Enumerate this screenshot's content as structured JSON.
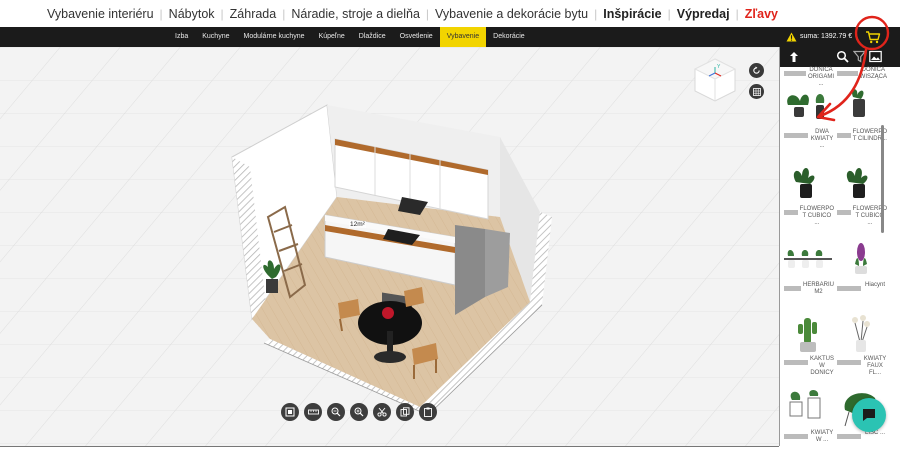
{
  "site_nav": {
    "items": [
      {
        "label": "Vybavenie interiéru",
        "style": "normal"
      },
      {
        "label": "Nábytok",
        "style": "normal"
      },
      {
        "label": "Záhrada",
        "style": "normal"
      },
      {
        "label": "Náradie, stroje a dielňa",
        "style": "normal"
      },
      {
        "label": "Vybavenie a dekorácie bytu",
        "style": "normal"
      },
      {
        "label": "Inšpirácie",
        "style": "bold"
      },
      {
        "label": "Výpredaj",
        "style": "bold"
      },
      {
        "label": "Zľavy",
        "style": "sale"
      }
    ],
    "separator": "|"
  },
  "category_bar": {
    "categories": [
      {
        "label": "Izba",
        "active": false
      },
      {
        "label": "Kuchyne",
        "active": false
      },
      {
        "label": "Modulárne kuchyne",
        "active": false
      },
      {
        "label": "Kúpeľne",
        "active": false
      },
      {
        "label": "Dlaždice",
        "active": false
      },
      {
        "label": "Osvetlenie",
        "active": false
      },
      {
        "label": "Vybavenie",
        "active": true
      },
      {
        "label": "Dekorácie",
        "active": false
      }
    ],
    "sum_label": "suma: 1392.79 €",
    "warning_icon": "warning-icon",
    "cart_icon": "cart-icon",
    "accent_color": "#f2d400"
  },
  "viewport": {
    "area_label": "12m²",
    "view_cube": {
      "axis_label": "Y"
    },
    "side_buttons": [
      "rotate-reset-icon",
      "grid-view-icon"
    ],
    "toolbar": [
      "frame-icon",
      "ruler-icon",
      "zoom-out-icon",
      "zoom-in-icon",
      "scissors-icon",
      "copy-icon",
      "paste-icon"
    ]
  },
  "panel": {
    "header_icons": [
      "back-up-icon",
      "search-icon",
      "filter-icon",
      "image-icon"
    ],
    "products": [
      {
        "name": "DONICA ORIGAMI ...",
        "thumb": "top-cut"
      },
      {
        "name": "DONICA WISZĄCA",
        "thumb": "top-cut"
      },
      {
        "name": "DWA KWIATY ...",
        "thumb": "plants-pair"
      },
      {
        "name": "FLOWERPO T CILINDR...",
        "thumb": "planter-dark"
      },
      {
        "name": "FLOWERPO T CUBICO ...",
        "thumb": "plant-black-pot"
      },
      {
        "name": "FLOWERPO T CUBICO ...",
        "thumb": "plant-black-pot"
      },
      {
        "name": "HERBARIU M2",
        "thumb": "herb-shelf"
      },
      {
        "name": "Hiacynt",
        "thumb": "hyacinth"
      },
      {
        "name": "KAKTUS W DONICY",
        "thumb": "cactus"
      },
      {
        "name": "KWIATY FAUX FL...",
        "thumb": "faux-flowers"
      },
      {
        "name": "KWIATY W ...",
        "thumb": "plant-stands"
      },
      {
        "name": "LIŚĆ ...",
        "thumb": "monstera"
      }
    ]
  },
  "chat_icon": "chat-icon",
  "annotation_color": "#e0241b"
}
